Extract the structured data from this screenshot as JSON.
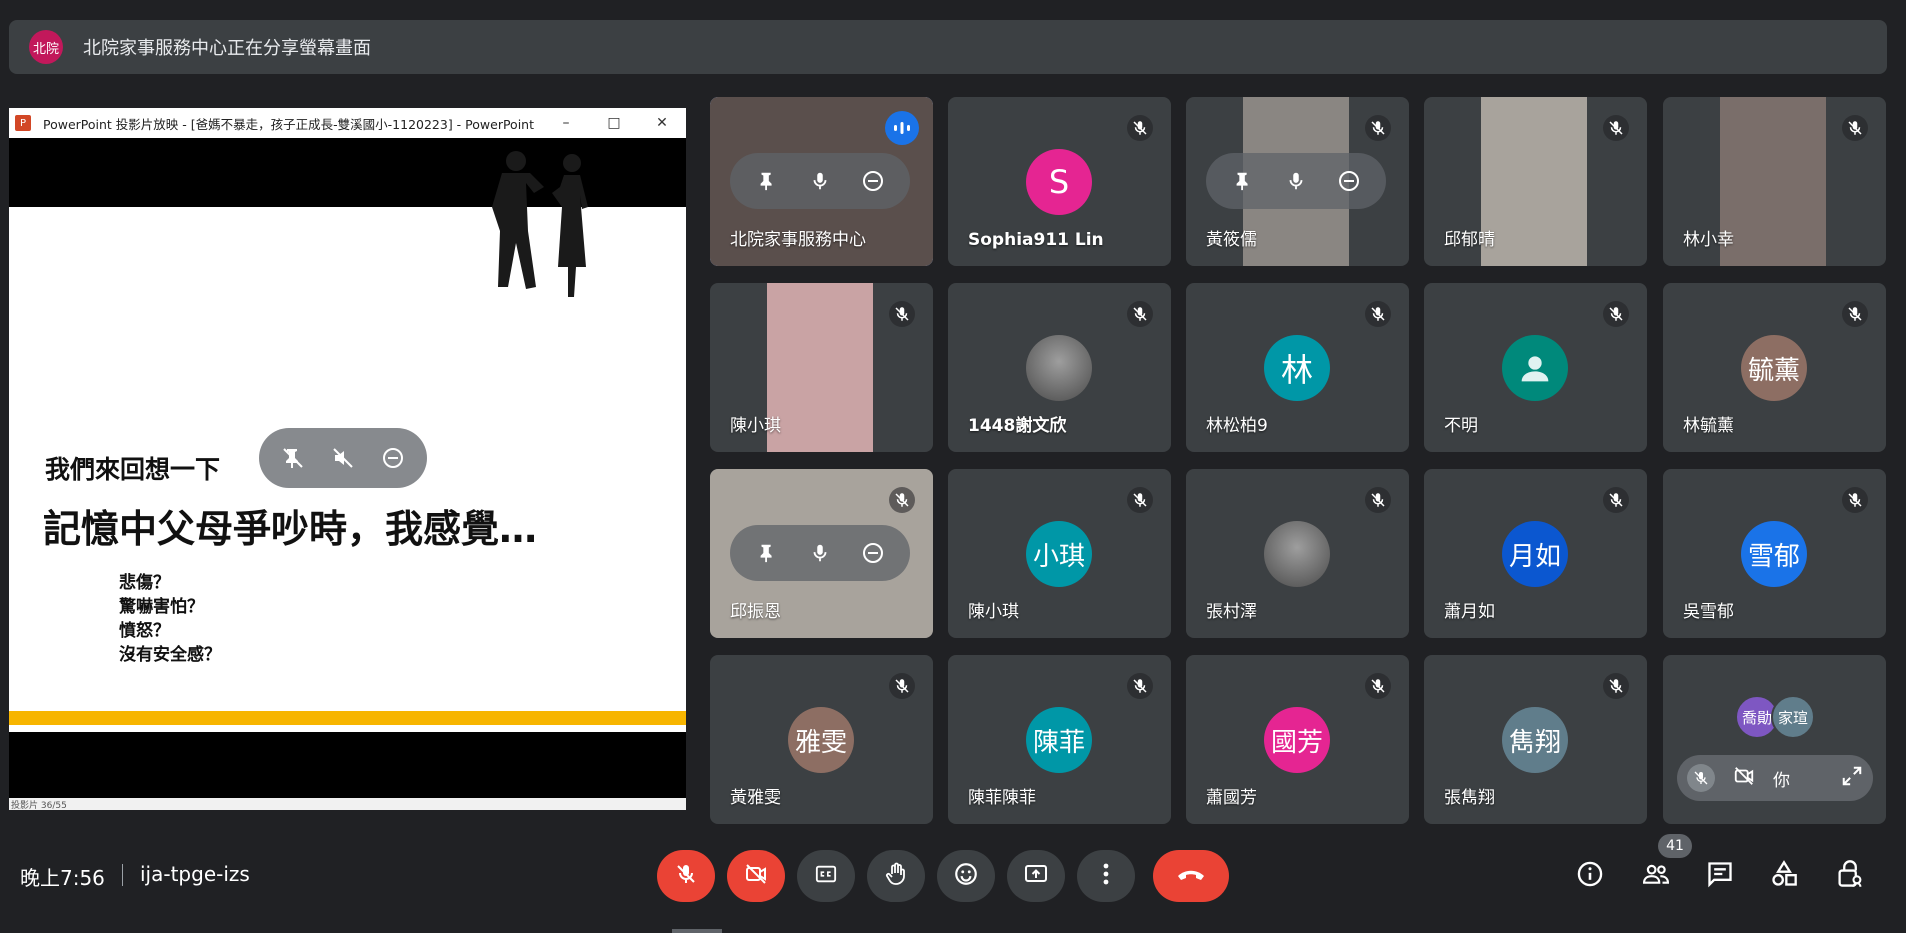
{
  "banner": {
    "avatar_text": "北院",
    "text": "北院家事服務中心正在分享螢幕畫面"
  },
  "presentation": {
    "window_title": "PowerPoint 投影片放映 - [爸媽不暴走，孩子正成長-雙溪國小-1120223] - PowerPoint",
    "logo": "P",
    "slide_subtitle": "我們來回想一下",
    "slide_heading": "記憶中父母爭吵時，我感覺…",
    "slide_items": [
      "悲傷？",
      "驚嚇害怕？",
      "憤怒？",
      "沒有安全感？"
    ],
    "status_text": "投影片 36/55"
  },
  "participants": [
    {
      "name": "北院家事服務中心",
      "type": "video",
      "speaking": true,
      "hover": true
    },
    {
      "name": "Sophia911 Lin",
      "type": "initial",
      "initial": "S",
      "color": "#e52592",
      "bold": true
    },
    {
      "name": "黃筱儒",
      "type": "video",
      "hover": true
    },
    {
      "name": "邱郁晴",
      "type": "video"
    },
    {
      "name": "林小幸",
      "type": "video"
    },
    {
      "name": "陳小琪",
      "type": "video"
    },
    {
      "name": "1448謝文欣",
      "type": "photo",
      "bold": true
    },
    {
      "name": "林松柏9",
      "type": "initial",
      "initial": "林",
      "color": "#0097a7"
    },
    {
      "name": "不明",
      "type": "person",
      "color": "#00897b"
    },
    {
      "name": "林毓薰",
      "type": "initial",
      "initial": "毓薰",
      "color": "#8d6e63"
    },
    {
      "name": "邱振恩",
      "type": "video",
      "hover": true
    },
    {
      "name": "陳小琪",
      "type": "initial",
      "initial": "小琪",
      "color": "#0097a7"
    },
    {
      "name": "張村澤",
      "type": "photo"
    },
    {
      "name": "蕭月如",
      "type": "initial",
      "initial": "月如",
      "color": "#0b57d0"
    },
    {
      "name": "吳雪郁",
      "type": "initial",
      "initial": "雪郁",
      "color": "#1a73e8"
    },
    {
      "name": "黃雅雯",
      "type": "initial",
      "initial": "雅雯",
      "color": "#8d6e63"
    },
    {
      "name": "陳菲陳菲",
      "type": "initial",
      "initial": "陳菲",
      "color": "#0097a7"
    },
    {
      "name": "蕭國芳",
      "type": "initial",
      "initial": "國芳",
      "color": "#e52592"
    },
    {
      "name": "張雋翔",
      "type": "initial",
      "initial": "雋翔",
      "color": "#607d8b"
    }
  ],
  "self_tile": {
    "you_label": "你",
    "mini_avatars": [
      {
        "text": "喬勛",
        "color": "#7e57c2"
      },
      {
        "text": "家瑄",
        "color": "#607d8b"
      }
    ]
  },
  "bottom": {
    "time": "晚上7:56",
    "code": "ija-tpge-izs",
    "participant_count": "41"
  }
}
